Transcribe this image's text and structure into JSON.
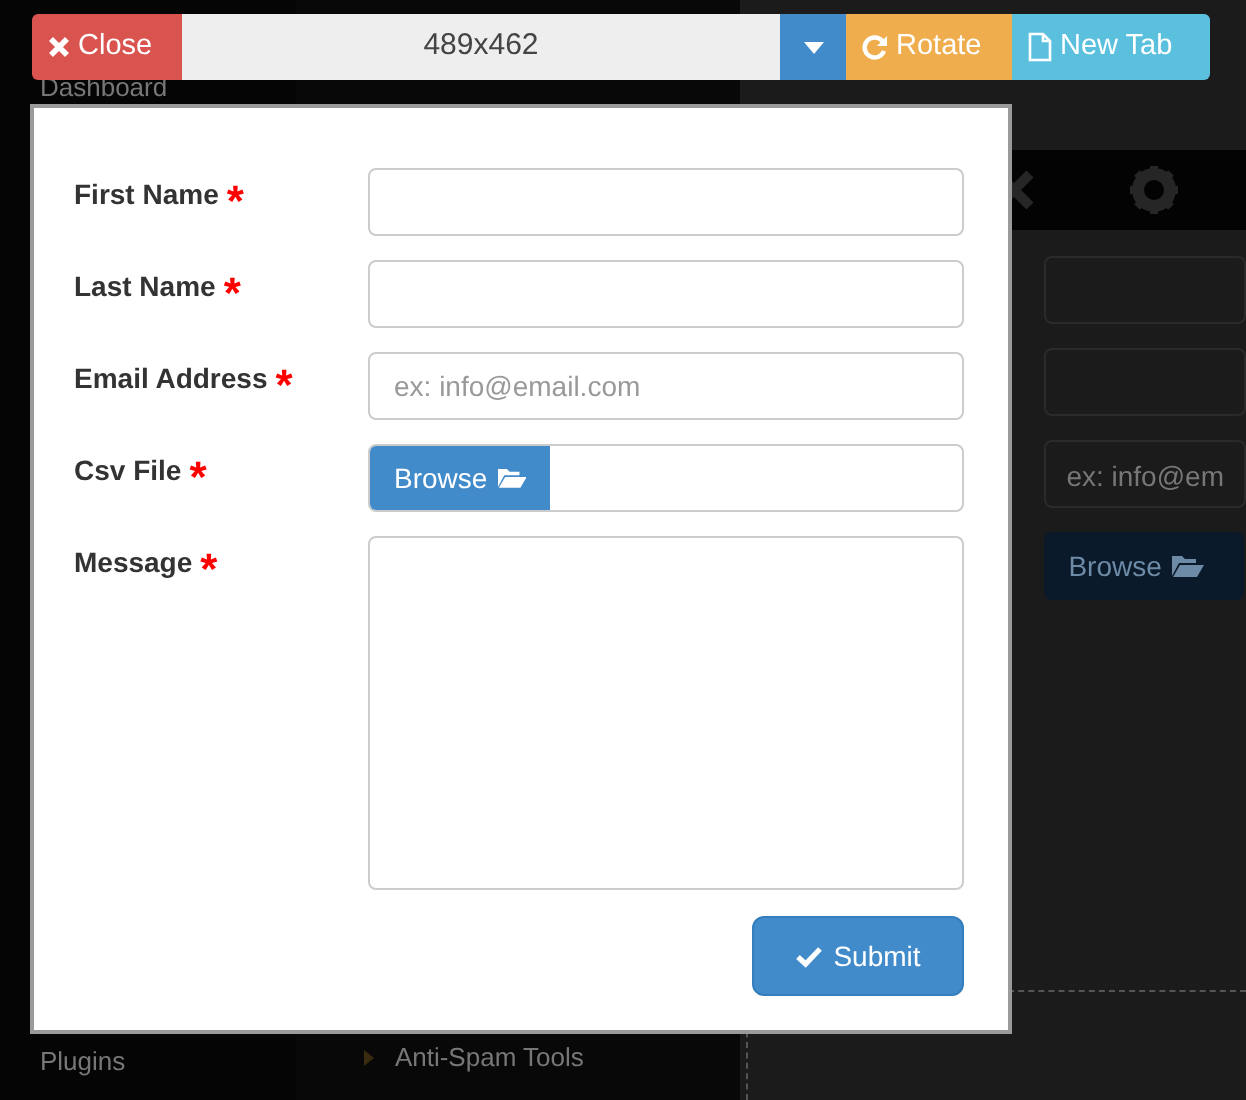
{
  "background": {
    "sidebar": [
      {
        "label": "Dashboard"
      },
      {
        "label": "Plugins"
      }
    ],
    "submenu": "Anti-Spam Tools",
    "preview": {
      "email_placeholder": "ex: info@em",
      "browse": "Browse"
    }
  },
  "toolbar": {
    "close": "Close",
    "size": "489x462",
    "rotate": "Rotate",
    "new_tab": "New Tab"
  },
  "form": {
    "fields": [
      {
        "kind": "text",
        "label": "First Name",
        "required_mark": "*"
      },
      {
        "kind": "text",
        "label": "Last Name",
        "required_mark": "*"
      },
      {
        "kind": "email",
        "label": "Email Address",
        "required_mark": "*",
        "placeholder": "ex: info@email.com"
      },
      {
        "kind": "file",
        "label": "Csv File",
        "required_mark": "*",
        "button": "Browse"
      },
      {
        "kind": "textarea",
        "label": "Message",
        "required_mark": "*"
      }
    ],
    "submit": "Submit"
  }
}
